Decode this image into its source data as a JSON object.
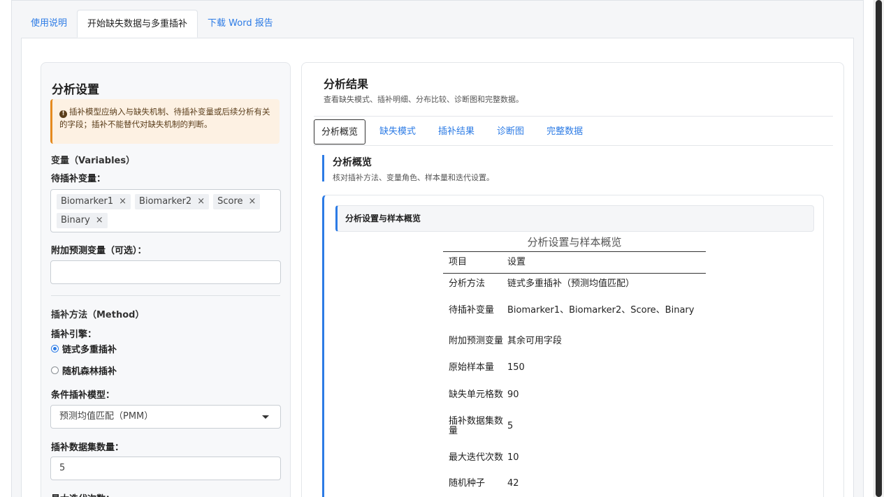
{
  "main_tabs": [
    {
      "label": "使用说明"
    },
    {
      "label": "开始缺失数据与多重插补"
    },
    {
      "label": "下载 Word 报告"
    }
  ],
  "sidebar": {
    "title": "分析设置",
    "alert_text": "插补模型应纳入与缺失机制、待插补变量或后续分析有关的字段；插补不能替代对缺失机制的判断。",
    "variables_heading": "变量（Variables）",
    "impute_vars_label": "待插补变量：",
    "impute_vars": [
      "Biomarker1",
      "Biomarker2",
      "Score",
      "Binary"
    ],
    "aux_vars_label": "附加预测变量（可选）：",
    "aux_vars_value": "",
    "method_heading": "插补方法（Method）",
    "engine_label": "插补引擎：",
    "engine_options": [
      {
        "label": "链式多重插补",
        "checked": true
      },
      {
        "label": "随机森林插补",
        "checked": false
      }
    ],
    "model_label": "条件插补模型：",
    "model_value": "预测均值匹配（PMM）",
    "n_datasets_label": "插补数据集数量：",
    "n_datasets_value": "5",
    "max_iter_label": "最大迭代次数："
  },
  "results": {
    "title": "分析结果",
    "subtitle": "查看缺失模式、插补明细、分布比较、诊断图和完整数据。",
    "sub_tabs": [
      {
        "label": "分析概览"
      },
      {
        "label": "缺失模式"
      },
      {
        "label": "插补结果"
      },
      {
        "label": "诊断图"
      },
      {
        "label": "完整数据"
      }
    ],
    "section_title": "分析概览",
    "section_subtitle": "核对插补方法、变量角色、样本量和迭代设置。",
    "card_header": "分析设置与样本概览",
    "table": {
      "caption": "分析设置与样本概览",
      "headers": [
        "项目",
        "设置"
      ],
      "rows": [
        {
          "item": "分析方法",
          "value": "链式多重插补（预测均值匹配）"
        },
        {
          "item": "待插补变量",
          "value": "Biomarker1、Biomarker2、Score、Binary"
        },
        {
          "item": "附加预测变量",
          "value": "其余可用字段"
        },
        {
          "item": "原始样本量",
          "value": "150"
        },
        {
          "item": "缺失单元格数",
          "value": "90"
        },
        {
          "item": "插补数据集数量",
          "value": "5"
        },
        {
          "item": "最大迭代次数",
          "value": "10"
        },
        {
          "item": "随机种子",
          "value": "42"
        }
      ]
    }
  }
}
